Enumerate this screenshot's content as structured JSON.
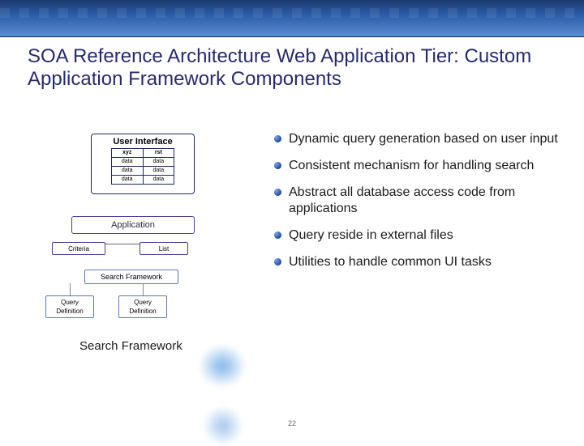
{
  "header": {
    "title": "SOA Reference Architecture Web Application Tier: Custom Application Framework Components"
  },
  "diagram": {
    "user_interface_label": "User Interface",
    "table": {
      "col1_header": "xyz",
      "col2_header": "rst",
      "rows": [
        {
          "c1": "data",
          "c2": "data"
        },
        {
          "c1": "data",
          "c2": "data"
        },
        {
          "c1": "data",
          "c2": "data"
        }
      ]
    },
    "application_label": "Application",
    "criteria_label": "Criteria",
    "list_label": "List",
    "search_framework_label": "Search Framework",
    "query_definition_label": "Query\nDefinition",
    "query_definition_label2": "Query\nDefinition",
    "section_title": "Search Framework"
  },
  "bullets": [
    "Dynamic query generation based on user input",
    "Consistent mechanism for handling search",
    "Abstract all database access code from applications",
    "Query reside in external files",
    "Utilities to handle common UI tasks"
  ],
  "page_number": "22"
}
